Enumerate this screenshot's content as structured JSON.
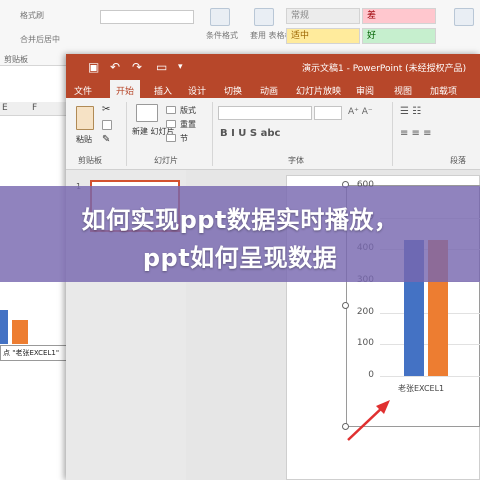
{
  "excel": {
    "ribbon": {
      "top_items": [
        "格式刷",
        "合并后居中"
      ],
      "conditional_format": "条件格式",
      "format_table": "套用\n表格格式",
      "styles": [
        "常规",
        "差",
        "适中",
        "好"
      ],
      "section_label": "剪贴板"
    },
    "column_headers": [
      "E",
      "F"
    ],
    "chart_tooltip": "点 \"老张EXCEL1\""
  },
  "powerpoint": {
    "title": "演示文稿1 - PowerPoint (未经授权产品)",
    "tabs": [
      "文件",
      "开始",
      "插入",
      "设计",
      "切换",
      "动画",
      "幻灯片放映",
      "审阅",
      "视图",
      "加载项"
    ],
    "active_tab": "开始",
    "ribbon": {
      "paste_label": "粘贴",
      "new_slide_label": "新建\n幻灯片",
      "layout_label": "版式",
      "reset_label": "重置",
      "section_label": "节",
      "groups": [
        "剪贴板",
        "幻灯片",
        "字体",
        "段落"
      ]
    },
    "thumbnail_number": "1",
    "accent_color": "#b7472a"
  },
  "chart_data": {
    "type": "bar",
    "categories": [
      "老张EXCEL1"
    ],
    "series": [
      {
        "values": [
          590
        ],
        "color": "#4472c4"
      },
      {
        "values": [
          1000
        ],
        "color": "#ed7d31"
      }
    ],
    "yticks": [
      0,
      100,
      200,
      300,
      400,
      500,
      600
    ],
    "ylim": [
      0,
      600
    ],
    "title": "",
    "xlabel": "",
    "ylabel": ""
  },
  "banner": {
    "line1": "如何实现ppt数据实时播放，",
    "line2": "ppt如何呈现数据"
  }
}
